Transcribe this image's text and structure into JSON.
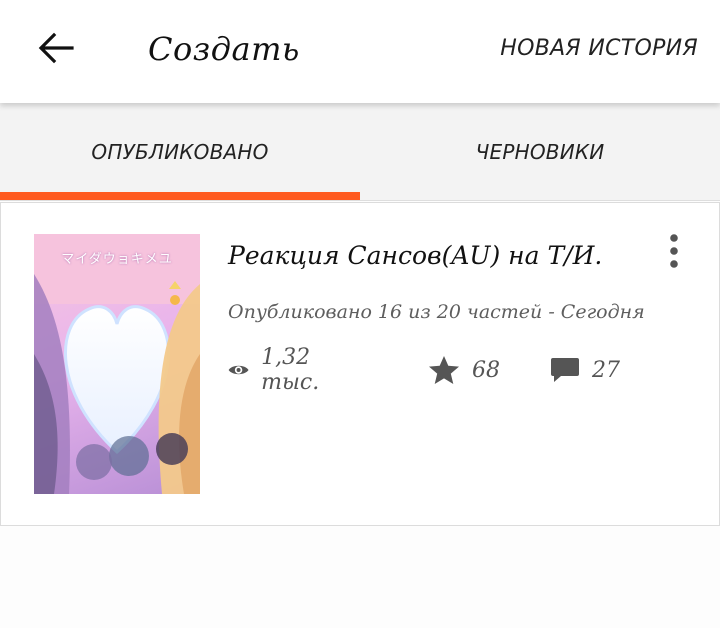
{
  "header": {
    "title": "Создать",
    "new_story_label": "НОВАЯ ИСТОРИЯ",
    "back_icon": "arrow-back-icon"
  },
  "tabs": [
    {
      "label": "ОПУБЛИКОВАНО",
      "active": true
    },
    {
      "label": "ЧЕРНОВИКИ",
      "active": false
    }
  ],
  "colors": {
    "accent": "#ff5a1f",
    "topbar_bg": "#ffffff",
    "tabs_bg": "#f3f3f3",
    "icon_gray": "#555555"
  },
  "story": {
    "title": "Реакция Сансов(AU) на Т/И.",
    "meta": "Опубликовано 16 из 20 частей - Сегодня",
    "reads": "1,32 тыс.",
    "votes": "68",
    "comments": "27",
    "cover_text": "マイダウョキメユ",
    "icons": {
      "reads": "eye-icon",
      "votes": "star-icon",
      "comments": "comment-icon",
      "menu": "more-vertical-icon"
    }
  }
}
